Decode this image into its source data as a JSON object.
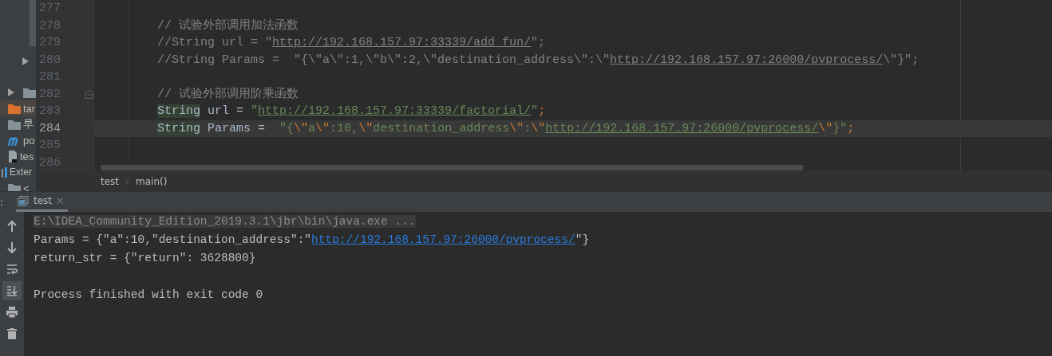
{
  "project_tree": {
    "items": [
      {
        "kind": "arrow",
        "selected": false
      },
      {
        "kind": "folder",
        "arrow": true,
        "selected": false
      },
      {
        "kind": "folder-excluded",
        "label": "tar",
        "arrow": false,
        "selected": true
      },
      {
        "kind": "folder",
        "label": "早",
        "arrow": false,
        "selected": false
      },
      {
        "kind": "maven",
        "label": "po",
        "arrow": false,
        "selected": false
      },
      {
        "kind": "file",
        "label": "tes",
        "arrow": false,
        "selected": false
      },
      {
        "kind": "library",
        "label": "Exter",
        "arrow": false,
        "selected": false
      },
      {
        "kind": "folder",
        "label": "<",
        "arrow": false,
        "selected": false
      }
    ]
  },
  "editor": {
    "lines": [
      {
        "number": "277",
        "current": false,
        "fold": false
      },
      {
        "number": "278",
        "current": false,
        "fold": false,
        "segments": [
          {
            "kind": "comment",
            "text": "// 试验外部调用加法函数"
          }
        ]
      },
      {
        "number": "279",
        "current": false,
        "fold": false,
        "segments": [
          {
            "kind": "comment",
            "text": "//String url = \""
          },
          {
            "kind": "comment-url",
            "text": "http://192.168.157.97:33339/add_fun/"
          },
          {
            "kind": "comment",
            "text": "\";"
          }
        ]
      },
      {
        "number": "280",
        "current": false,
        "fold": false,
        "segments": [
          {
            "kind": "comment",
            "text": "//String Params =  \"{\\\"a\\\":1,\\\"b\\\":2,\\\"destination_address\\\":\\\""
          },
          {
            "kind": "comment-url",
            "text": "http://192.168.157.97:26000/pvprocess/"
          },
          {
            "kind": "comment",
            "text": "\\\"}\";"
          }
        ]
      },
      {
        "number": "281",
        "current": false,
        "fold": false
      },
      {
        "number": "282",
        "current": false,
        "fold": true,
        "segments": [
          {
            "kind": "comment",
            "text": "// 试验外部调用阶乘函数"
          }
        ]
      },
      {
        "number": "283",
        "current": false,
        "fold": false,
        "segments": [
          {
            "kind": "ident-highlight",
            "text": "String"
          },
          {
            "kind": "plain",
            "text": " url = "
          },
          {
            "kind": "string",
            "text": "\""
          },
          {
            "kind": "string-url",
            "text": "http://192.168.157.97:33339/factorial/"
          },
          {
            "kind": "string",
            "text": "\""
          },
          {
            "kind": "punct",
            "text": ";"
          }
        ]
      },
      {
        "number": "284",
        "current": true,
        "fold": false,
        "segments": [
          {
            "kind": "ident-highlight",
            "text": "String"
          },
          {
            "kind": "plain",
            "text": " Params =  "
          },
          {
            "kind": "string",
            "text": "\"{"
          },
          {
            "kind": "escape",
            "text": "\\\""
          },
          {
            "kind": "string",
            "text": "a"
          },
          {
            "kind": "escape",
            "text": "\\\""
          },
          {
            "kind": "string",
            "text": ":10,"
          },
          {
            "kind": "escape",
            "text": "\\\""
          },
          {
            "kind": "string",
            "text": "destination_address"
          },
          {
            "kind": "escape",
            "text": "\\\""
          },
          {
            "kind": "string",
            "text": ":"
          },
          {
            "kind": "escape",
            "text": "\\\""
          },
          {
            "kind": "string-url",
            "text": "http://192.168.157.97:26000/pvprocess/"
          },
          {
            "kind": "escape",
            "text": "\\\""
          },
          {
            "kind": "string",
            "text": "}\""
          },
          {
            "kind": "punct",
            "text": ";"
          }
        ]
      },
      {
        "number": "285",
        "current": false,
        "fold": false
      },
      {
        "number": "286",
        "current": false,
        "fold": false
      }
    ]
  },
  "breadcrumbs": [
    "test",
    "main()"
  ],
  "run_panel": {
    "label": ":",
    "tabs": [
      {
        "label": "test",
        "selected": true
      }
    ],
    "toolbar": [
      {
        "kind": "up",
        "selected": false
      },
      {
        "kind": "down",
        "selected": false
      },
      {
        "kind": "wrap",
        "selected": false
      },
      {
        "kind": "scroll-end",
        "selected": true
      },
      {
        "kind": "print",
        "selected": false
      },
      {
        "kind": "trash",
        "selected": false
      }
    ],
    "console": [
      {
        "kind": "command",
        "segments": [
          {
            "kind": "text",
            "text": "E:\\IDEA_Community_Edition_2019.3.1\\jbr\\bin\\java.exe ..."
          }
        ]
      },
      {
        "kind": "output",
        "segments": [
          {
            "kind": "text",
            "text": "Params = {\"a\":10,\"destination_address\":\""
          },
          {
            "kind": "link",
            "text": "http://192.168.157.97:26000/pvprocess/"
          },
          {
            "kind": "text",
            "text": "\"}"
          }
        ]
      },
      {
        "kind": "output",
        "segments": [
          {
            "kind": "text",
            "text": "return_str = {\"return\": 3628800}"
          }
        ]
      },
      {
        "kind": "exit",
        "segments": [
          {
            "kind": "text",
            "text": "Process finished with exit code 0"
          }
        ]
      }
    ]
  }
}
